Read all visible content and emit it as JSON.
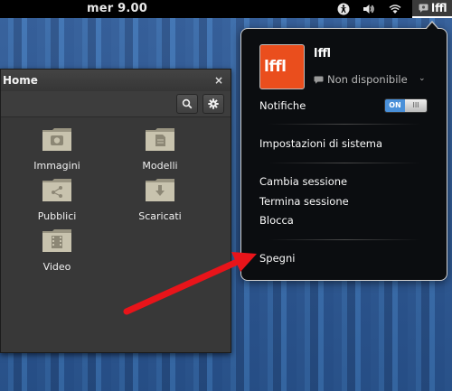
{
  "topbar": {
    "clock": "mer  9.00",
    "icons": [
      "accessibility-icon",
      "volume-icon",
      "wifi-icon",
      "user-status-icon"
    ],
    "user_name": "lffl"
  },
  "file_manager": {
    "title": "Home",
    "close_glyph": "×",
    "toolbar_icons": [
      "search-icon",
      "gear-icon"
    ],
    "items": [
      {
        "label": "Immagini",
        "icon": "pictures-folder-icon"
      },
      {
        "label": "Modelli",
        "icon": "templates-folder-icon"
      },
      {
        "label": "Pubblici",
        "icon": "public-folder-icon"
      },
      {
        "label": "Scaricati",
        "icon": "downloads-folder-icon"
      },
      {
        "label": "Video",
        "icon": "videos-folder-icon"
      }
    ]
  },
  "user_menu": {
    "avatar_text": "lffl",
    "username": "lffl",
    "status": "Non disponibile",
    "notifications_label": "Notifiche",
    "toggle_on": "ON",
    "toggle_knob": "III",
    "system_settings": "Impostazioni di sistema",
    "switch_user": "Cambia sessione",
    "log_out": "Termina sessione",
    "lock": "Blocca",
    "power_off": "Spegni"
  },
  "colors": {
    "accent": "#4a90d9",
    "avatar_bg": "#ea4e1d",
    "annotation_arrow": "#e8141a",
    "desktop": "#2f5b9a"
  }
}
